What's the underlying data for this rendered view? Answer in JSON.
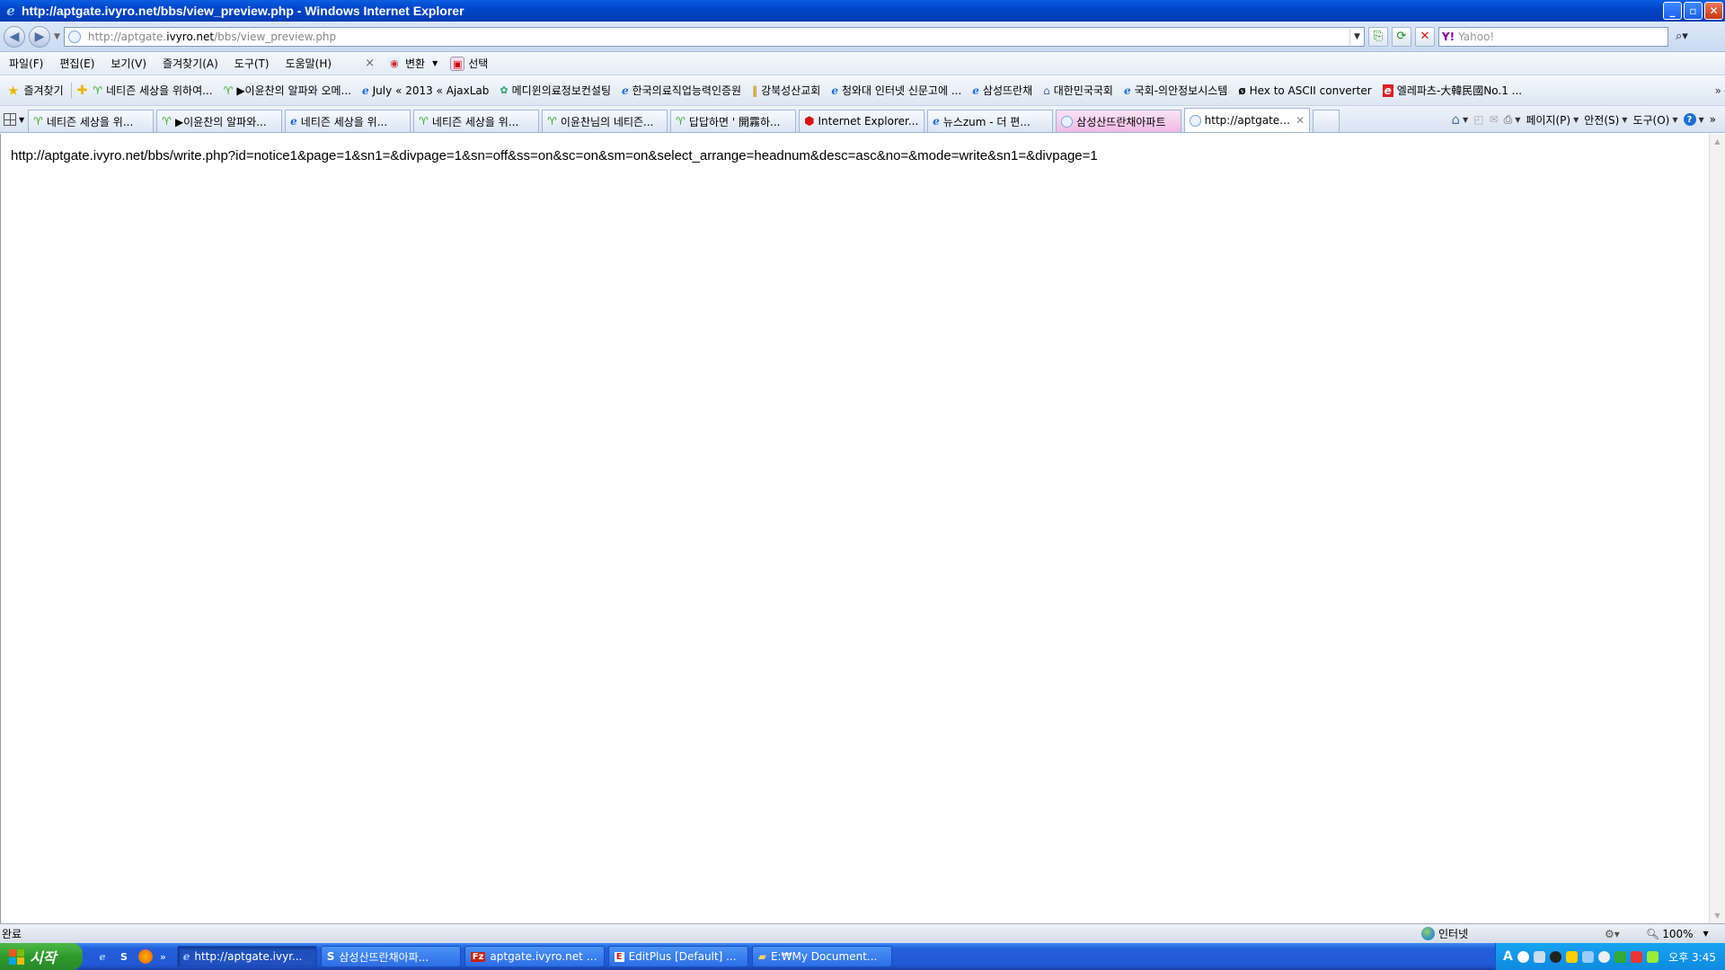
{
  "window": {
    "title": "http://aptgate.ivyro.net/bbs/view_preview.php - Windows Internet Explorer"
  },
  "addressbar": {
    "url_prefix": "http://aptgate.",
    "url_domain": "ivyro.net",
    "url_path": "/bbs/view_preview.php",
    "search_placeholder": "Yahoo!"
  },
  "menu": {
    "items": [
      "파일(F)",
      "편집(E)",
      "보기(V)",
      "즐겨찾기(A)",
      "도구(T)",
      "도움말(H)"
    ],
    "close_glyph": "×",
    "convert_label": "변환",
    "select_label": "선택"
  },
  "favorites": {
    "title": "즐겨찾기",
    "items": [
      "네티즌 세상을 위하여...",
      "▶이윤찬의 알파와 오메...",
      "July « 2013 « AjaxLab",
      "메디윈의료정보컨설팅",
      "한국의료직업능력인증원",
      "강북성산교회",
      "청와대 인터넷 신문고에 ...",
      "삼성뜨란채",
      "대한민국국회",
      "국회-의안정보시스템",
      "Hex to ASCII converter",
      "엘레파츠-大韓民國No.1 ..."
    ]
  },
  "tabs": [
    {
      "label": "네티즌 세상을 위...",
      "icon": "sprout"
    },
    {
      "label": "▶이윤찬의 알파와...",
      "icon": "sprout"
    },
    {
      "label": "네티즌 세상을 위...",
      "icon": "ie"
    },
    {
      "label": "네티즌 세상을 위...",
      "icon": "sprout"
    },
    {
      "label": "이윤찬님의 네티즌...",
      "icon": "sprout"
    },
    {
      "label": "답답하면 ' 開霧하...",
      "icon": "sprout"
    },
    {
      "label": "Internet Explorer...",
      "icon": "red-hex"
    },
    {
      "label": "뉴스zum - 더 편...",
      "icon": "ie"
    },
    {
      "label": "삼성산뜨란채아파트",
      "icon": "page"
    },
    {
      "label": "http://aptgate.i...",
      "icon": "page"
    }
  ],
  "commandbar": {
    "page": "페이지(P)",
    "safety": "안전(S)",
    "tools": "도구(O)"
  },
  "content": {
    "text": "http://aptgate.ivyro.net/bbs/write.php?id=notice1&page=1&sn1=&divpage=1&sn=off&ss=on&sc=on&sm=on&select_arrange=headnum&desc=asc&no=&mode=write&sn1=&divpage=1"
  },
  "statusbar": {
    "status": "완료",
    "zone": "인터넷",
    "zoom": "100%"
  },
  "taskbar": {
    "start": "시작",
    "buttons": [
      "http://aptgate.ivyr...",
      "삼성산뜨란채아파...",
      "aptgate.ivyro.net -...",
      "EditPlus [Default] ...",
      "E:₩My Document..."
    ],
    "clock": "오후 3:45"
  },
  "colors": {
    "titlebar": "#0245c9",
    "taskbar": "#245edb",
    "start_green": "#2f9a2c",
    "active_tab_pink": "#f0b9e6"
  }
}
